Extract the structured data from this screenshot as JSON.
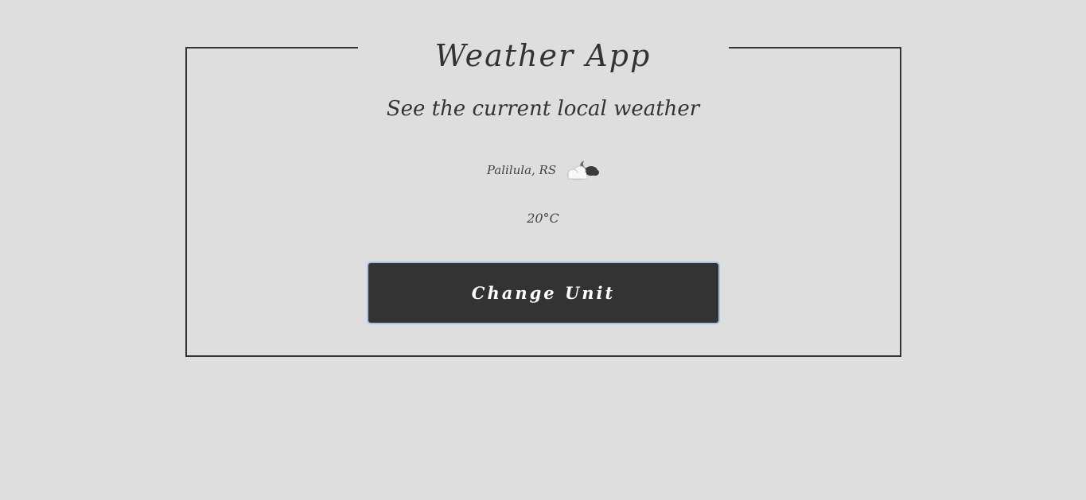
{
  "header": {
    "title": "Weather App",
    "subtitle": "See the current local weather"
  },
  "weather": {
    "location": "Palilula, RS",
    "icon": "partly-cloudy-night-icon",
    "temperature": "20°C"
  },
  "actions": {
    "change_unit_label": "Change Unit"
  },
  "colors": {
    "background": "#dedede",
    "frame_border": "#333333",
    "button_bg": "#333333",
    "button_text": "#ffffff",
    "button_focus_ring": "#a9c2e0"
  }
}
